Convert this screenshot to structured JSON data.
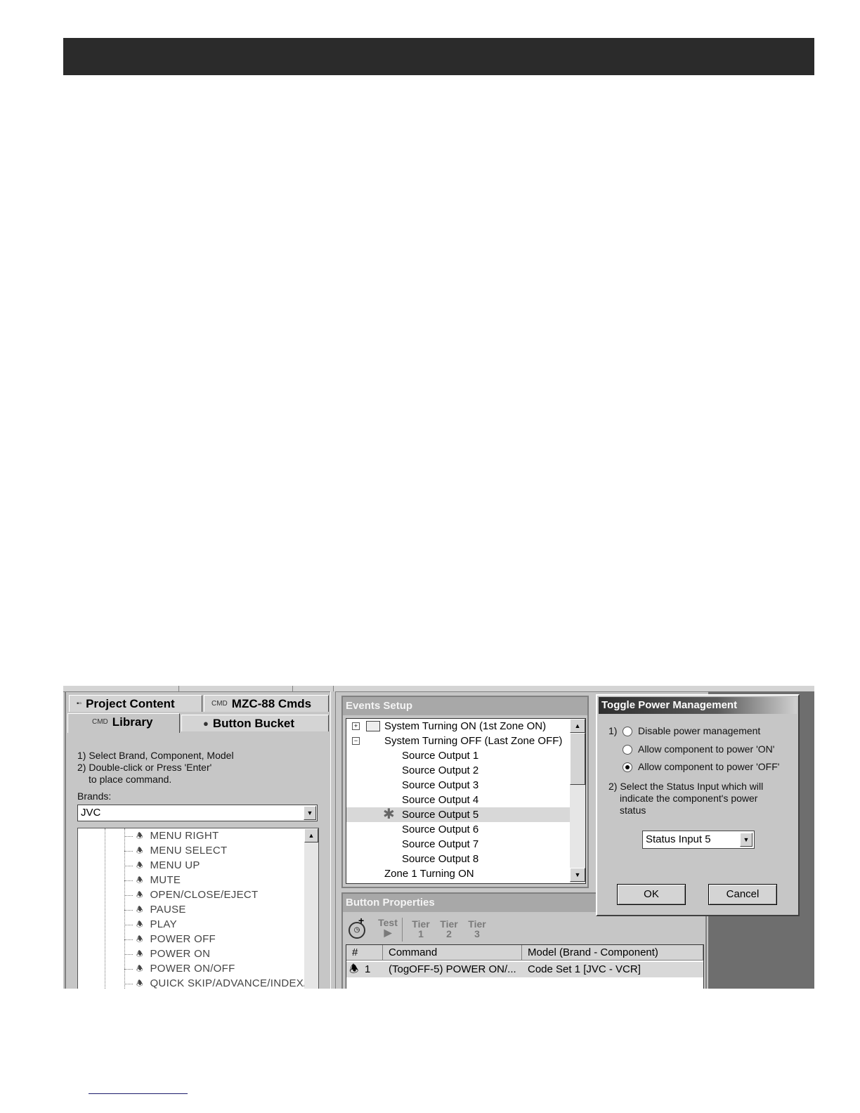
{
  "tabs": {
    "project_content": "Project Content",
    "mzc_cmds": "MZC-88 Cmds",
    "library": "Library",
    "button_bucket": "Button Bucket",
    "cmd_icon": "CMD"
  },
  "library": {
    "instruction_1": "1) Select Brand, Component, Model",
    "instruction_2": "2) Double-click or Press 'Enter'",
    "instruction_3": "to place command.",
    "brands_label": "Brands:",
    "brand_value": "JVC",
    "commands": [
      "MENU RIGHT",
      "MENU SELECT",
      "MENU UP",
      "MUTE",
      "OPEN/CLOSE/EJECT",
      "PAUSE",
      "PLAY",
      "POWER OFF",
      "POWER ON",
      "POWER ON/OFF",
      "QUICK SKIP/ADVANCE/INDEX/T"
    ]
  },
  "events": {
    "title": "Events Setup",
    "items": [
      "System Turning ON (1st Zone ON)",
      "System Turning OFF (Last Zone OFF)",
      "Source Output 1",
      "Source Output 2",
      "Source Output 3",
      "Source Output 4",
      "Source Output 5",
      "Source Output 6",
      "Source Output 7",
      "Source Output 8",
      "Zone 1 Turning ON"
    ],
    "selected_index": 6
  },
  "button_properties": {
    "title": "Button Properties",
    "toolbar": {
      "test": "Test",
      "tier": "Tier",
      "tier1": "1",
      "tier2": "2",
      "tier3": "3"
    },
    "columns": [
      "#",
      "Command",
      "Model (Brand - Component)"
    ],
    "row": {
      "num": "1",
      "command": "(TogOFF-5) POWER ON/...",
      "model": "Code Set 1 [JVC - VCR]"
    }
  },
  "dialog": {
    "title": "Toggle Power Management",
    "step1": "1)",
    "options": [
      "Disable power management",
      "Allow component to power 'ON'",
      "Allow component to power 'OFF'"
    ],
    "selected_option": 2,
    "step2_line1": "2) Select the Status Input which will",
    "step2_line2": "indicate the component's power",
    "step2_line3": "status",
    "status_value": "Status Input 5",
    "ok": "OK",
    "cancel": "Cancel"
  },
  "icons": {
    "remote": "remote-icon",
    "folder": "folder-icon",
    "clock": "clock-icon",
    "star": "star-icon"
  }
}
